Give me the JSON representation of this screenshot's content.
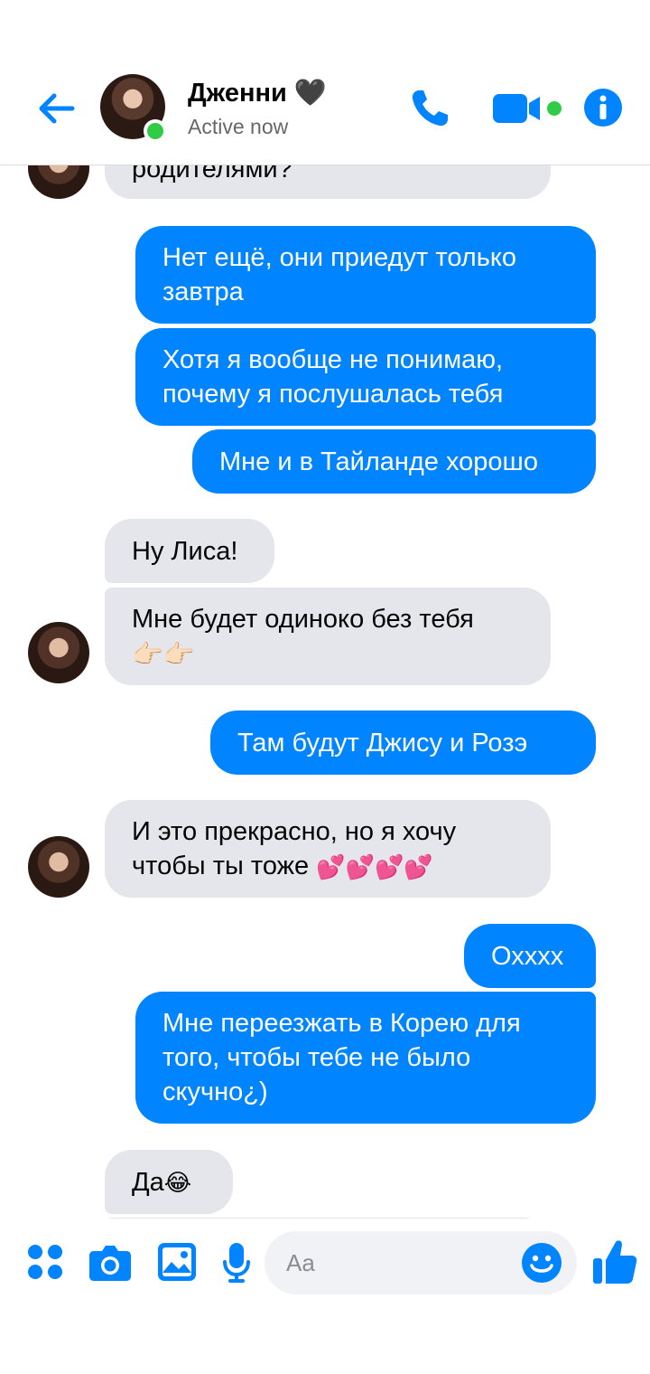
{
  "header": {
    "name": "Дженни 🖤",
    "status": "Active now"
  },
  "messages": [
    {
      "id": "m0",
      "side": "in",
      "text": "родителями?"
    },
    {
      "id": "m1",
      "side": "out",
      "text": "Нет ещё, они приедут только завтра"
    },
    {
      "id": "m2",
      "side": "out",
      "text": "Хотя я вообще не понимаю, почему я послушалась тебя"
    },
    {
      "id": "m3",
      "side": "out",
      "text": "Мне и в Тайланде хорошо"
    },
    {
      "id": "m4",
      "side": "in",
      "text": "Ну Лиса!"
    },
    {
      "id": "m5",
      "side": "in",
      "text": "Мне будет одиноко без тебя",
      "emoji": "👉🏻👉🏻"
    },
    {
      "id": "m6",
      "side": "out",
      "text": "Там будут Джису и Розэ"
    },
    {
      "id": "m7",
      "side": "in",
      "text": "И это прекрасно, но я хочу чтобы ты тоже",
      "emoji": "💕💕💕💕"
    },
    {
      "id": "m8",
      "side": "out",
      "text": "Охххх"
    },
    {
      "id": "m9",
      "side": "out",
      "text": "Мне переезжать в Корею для того, чтобы тебе не было скучно¿)"
    },
    {
      "id": "m10",
      "side": "in",
      "text": "Да",
      "emoji": "😂"
    }
  ],
  "composer": {
    "placeholder": "Aa"
  },
  "icons": {
    "back": "arrow-left-icon",
    "call": "phone-icon",
    "video": "video-camera-icon",
    "info": "info-icon",
    "menu": "four-dots-icon",
    "camera": "camera-icon",
    "gallery": "image-icon",
    "mic": "microphone-icon",
    "emoji": "smiley-icon",
    "like": "thumbs-up-icon"
  },
  "colors": {
    "accent": "#0084ff",
    "incoming_bubble": "#e4e6eb",
    "online": "#31cc46"
  }
}
